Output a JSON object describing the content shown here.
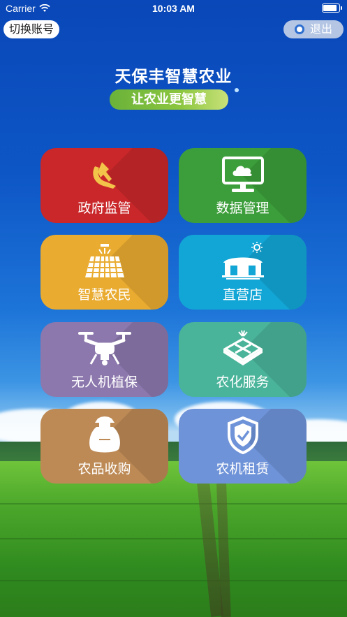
{
  "status_bar": {
    "carrier": "Carrier",
    "time": "10:03 AM"
  },
  "header": {
    "switch_account": "切换账号",
    "logout": "退出"
  },
  "app": {
    "title": "天保丰智慧农业",
    "slogan": "让农业更智慧"
  },
  "tiles": [
    {
      "label": "政府监管",
      "icon": "party-emblem-icon",
      "color": "#c9272a"
    },
    {
      "label": "数据管理",
      "icon": "monitor-cloud-icon",
      "color": "#3c9e3a"
    },
    {
      "label": "智慧农民",
      "icon": "solar-panel-icon",
      "color": "#e9ab30"
    },
    {
      "label": "直营店",
      "icon": "greenhouse-store-icon",
      "color": "#12a6d6"
    },
    {
      "label": "无人机植保",
      "icon": "drone-icon",
      "color": "#8c78ad"
    },
    {
      "label": "农化服务",
      "icon": "fertilizer-icon",
      "color": "#4ab49a"
    },
    {
      "label": "农品收购",
      "icon": "grain-sack-icon",
      "color": "#bd8a55"
    },
    {
      "label": "农机租赁",
      "icon": "shield-check-icon",
      "color": "#6f93d8"
    }
  ]
}
